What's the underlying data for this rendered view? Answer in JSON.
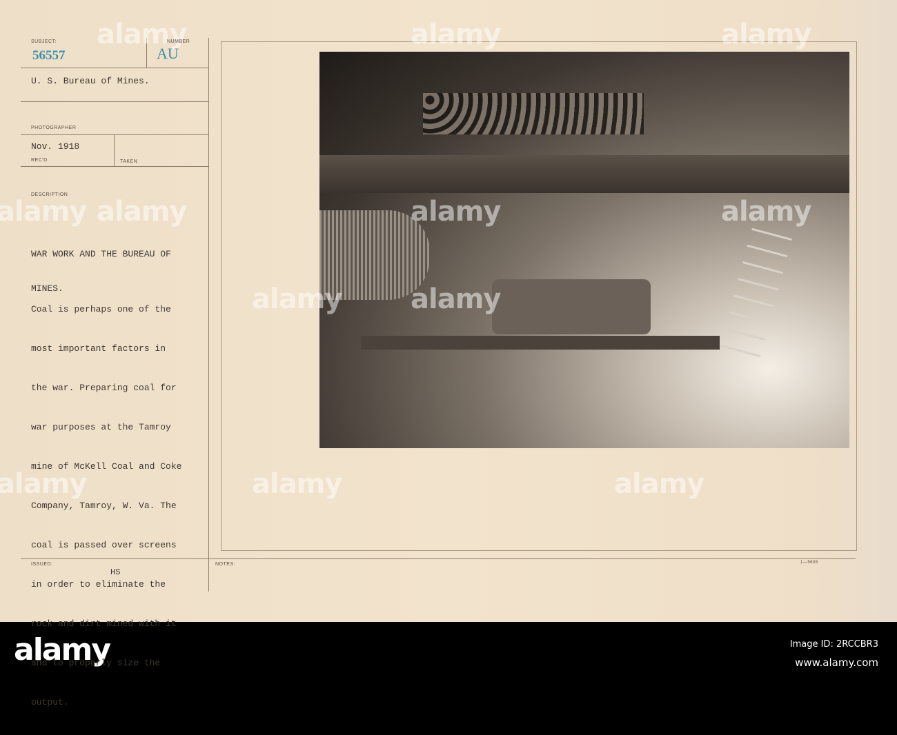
{
  "card": {
    "subject_label": "SUBJECT:",
    "subject_number": "56557",
    "number_label": "NUMBER",
    "number_value": "AU",
    "source": "U. S. Bureau of Mines.",
    "photographer_label": "PHOTOGRAPHER",
    "date": "Nov. 1918",
    "recd_label": "REC'D",
    "taken_label": "TAKEN",
    "description_label": "DESCRIPTION",
    "title_lines": [
      "WAR WORK AND THE BUREAU OF",
      "MINES."
    ],
    "description_lines": [
      "Coal is perhaps one of the",
      "most important factors in",
      "the war. Preparing coal for",
      "war purposes at the Tamroy",
      "mine of McKell Coal and Coke",
      "Company, Tamroy, W. Va. The",
      "coal is passed over screens",
      "in order to eliminate the",
      "rock and dirt mined with it",
      "and to properly size the",
      "output."
    ],
    "issued_label": "ISSUED:",
    "issued_value": "HS",
    "notes_label": "NOTES:",
    "form_number": "1—5605"
  },
  "watermark": "alamy",
  "footer": {
    "logo": "alamy",
    "image_id": "Image ID: 2RCCBR3",
    "url": "www.alamy.com"
  }
}
